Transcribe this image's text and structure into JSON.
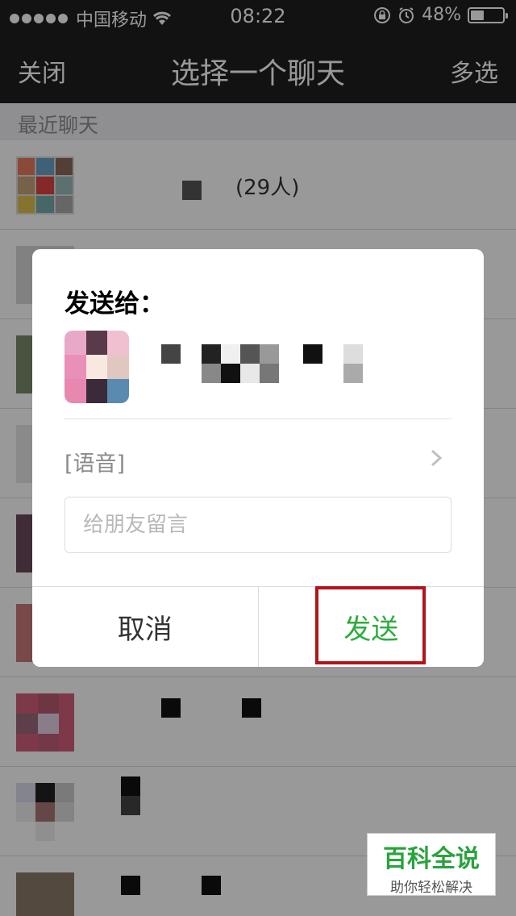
{
  "status_bar": {
    "carrier": "中国移动",
    "time": "08:22",
    "battery": "48%",
    "battery_level": 0.48
  },
  "nav": {
    "close_label": "关闭",
    "title": "选择一个聊天",
    "multi_select_label": "多选"
  },
  "recent_header": "最近聊天",
  "chats": [
    {
      "name_suffix": "(29人)"
    }
  ],
  "dialog": {
    "send_to_label": "发送给：",
    "attachment_label": "[语音]",
    "message_placeholder": "给朋友留言",
    "cancel_label": "取消",
    "send_label": "发送"
  },
  "watermark": {
    "title": "百科全说",
    "subtitle": "助你轻松解决"
  },
  "colors": {
    "send_button": "#2dad3c",
    "highlight_border": "#b3131b",
    "nav_background": "#1f1f1f"
  }
}
